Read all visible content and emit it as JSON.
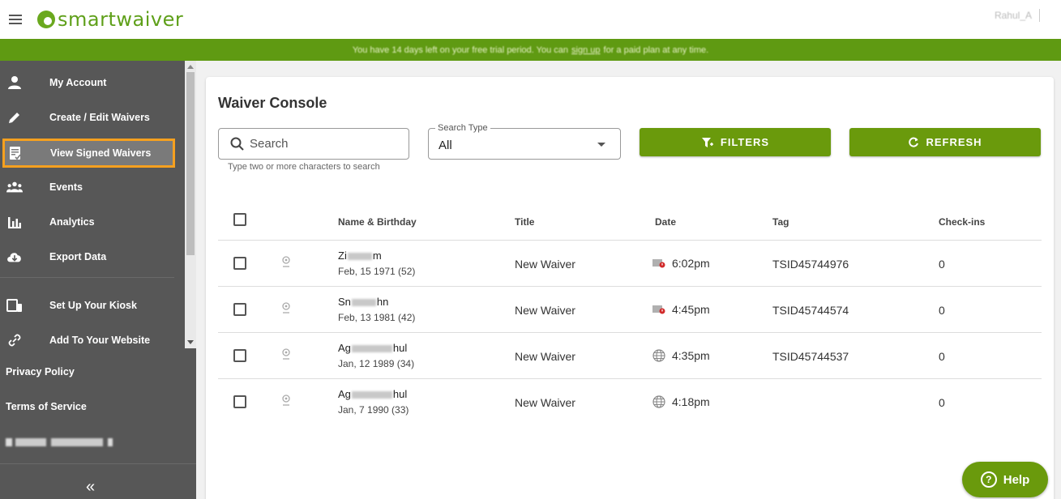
{
  "header": {
    "logo_text": "smartwaiver",
    "user_name": "Rahul_A"
  },
  "banner": {
    "text_before": "You have 14 days left on your free trial period. You can",
    "link": "sign up",
    "text_after": "for a paid plan at any time."
  },
  "sidebar": {
    "items": [
      {
        "label": "My Account",
        "icon": "user-icon"
      },
      {
        "label": "Create / Edit Waivers",
        "icon": "pencil-icon"
      },
      {
        "label": "View Signed Waivers",
        "icon": "signed-document-icon",
        "active": true
      },
      {
        "label": "Events",
        "icon": "people-group-icon"
      },
      {
        "label": "Analytics",
        "icon": "bar-chart-icon"
      },
      {
        "label": "Export Data",
        "icon": "cloud-download-icon"
      },
      {
        "label": "Set Up Your Kiosk",
        "icon": "kiosk-devices-icon"
      },
      {
        "label": "Add To Your Website",
        "icon": "link-icon"
      }
    ],
    "privacy": "Privacy Policy",
    "terms": "Terms of Service",
    "collapse": "«"
  },
  "console": {
    "title": "Waiver Console",
    "search_placeholder": "Search",
    "search_hint": "Type two or more characters to search",
    "search_type_label": "Search Type",
    "search_type_value": "All",
    "filters_label": "FILTERS",
    "refresh_label": "REFRESH"
  },
  "table": {
    "columns": [
      "Name & Birthday",
      "Title",
      "Date",
      "Tag",
      "Check-ins"
    ],
    "rows": [
      {
        "name_start": "Zi",
        "name_end": "m",
        "birthday": "Feb, 15 1971 (52)",
        "title": "New Waiver",
        "date_icon": "kiosk-signed-icon",
        "date": "6:02pm",
        "tag": "TSID45744976",
        "checkins": "0"
      },
      {
        "name_start": "Sn",
        "name_end": "hn",
        "birthday": "Feb, 13 1981 (42)",
        "title": "New Waiver",
        "date_icon": "kiosk-signed-icon",
        "date": "4:45pm",
        "tag": "TSID45744574",
        "checkins": "0"
      },
      {
        "name_start": "Ag",
        "name_end": "hul",
        "birthday": "Jan, 12 1989 (34)",
        "title": "New Waiver",
        "date_icon": "web-globe-icon",
        "date": "4:35pm",
        "tag": "TSID45744537",
        "checkins": "0"
      },
      {
        "name_start": "Ag",
        "name_end": "hul",
        "birthday": "Jan, 7 1990 (33)",
        "title": "New Waiver",
        "date_icon": "web-globe-icon",
        "date": "4:18pm",
        "tag": "",
        "checkins": "0"
      }
    ]
  },
  "help": {
    "label": "Help"
  },
  "colors": {
    "brand_green": "#6a9a0c",
    "banner_green": "#5f9a12",
    "sidebar_bg": "#575757",
    "active_outline": "#f5a01f"
  }
}
